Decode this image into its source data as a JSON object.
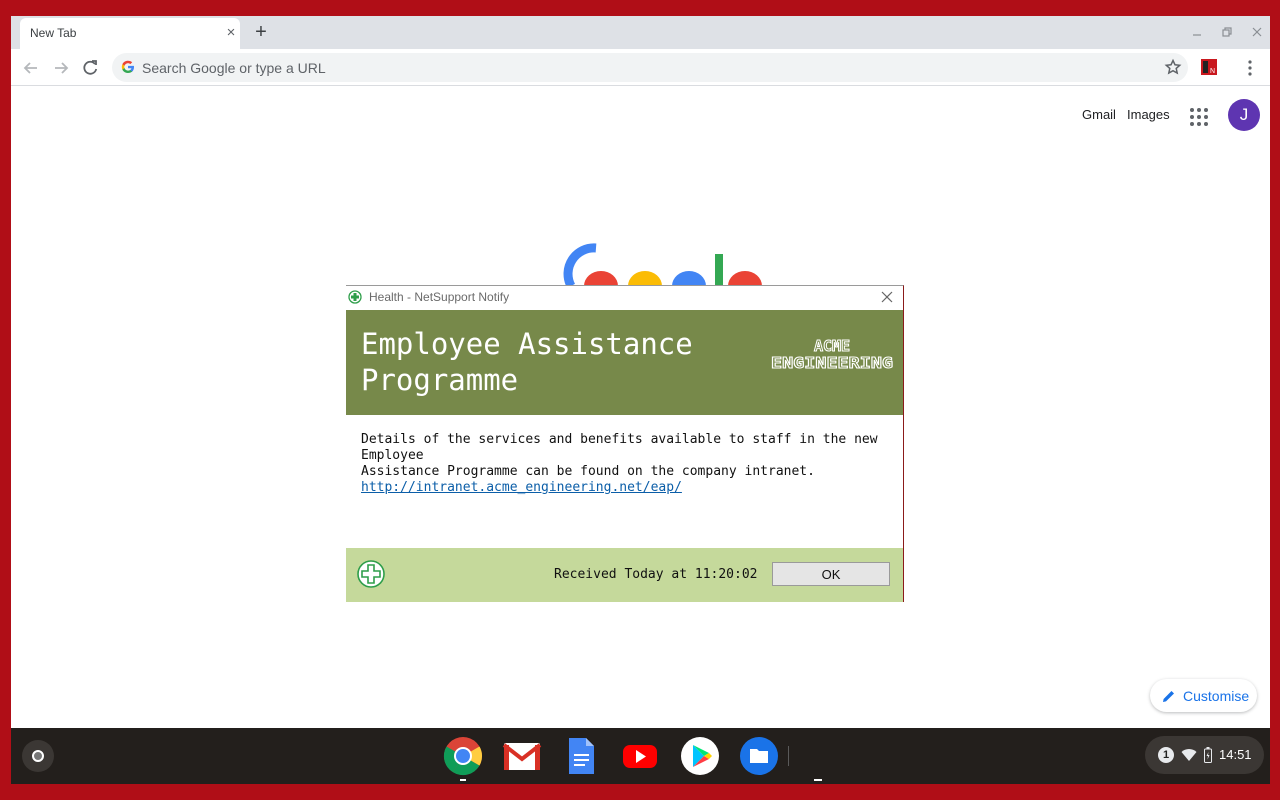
{
  "browser": {
    "tab_title": "New Tab",
    "tab_close": "×",
    "new_tab": "+",
    "omnibox_placeholder": "Search Google or type a URL"
  },
  "ntp": {
    "gmail": "Gmail",
    "images": "Images",
    "avatar_letter": "J",
    "customise": "Customise"
  },
  "dialog": {
    "title": "Health - NetSupport Notify",
    "heading_line1": "Employee Assistance",
    "heading_line2": "Programme",
    "logo_line1": "ACME",
    "logo_line2": "ENGINEERING",
    "body_line1": "Details of the services and benefits available to staff in the new Employee",
    "body_line2": "Assistance Programme can be found on the company intranet.",
    "link": "http://intranet.acme_engineering.net/eap/",
    "received": "Received Today at 11:20:02",
    "ok": "OK"
  },
  "shelf": {
    "apps": [
      "Chrome",
      "Gmail",
      "Docs",
      "YouTube",
      "Play Store",
      "Files"
    ],
    "notification_count": "1",
    "time": "14:51"
  },
  "colors": {
    "desktop": "#b00e17",
    "dialog_header": "#77894a",
    "dialog_footer": "#c5d99b",
    "avatar": "#5e35b1",
    "accent": "#1a73e8"
  }
}
